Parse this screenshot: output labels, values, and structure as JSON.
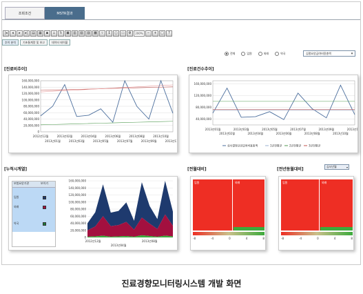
{
  "tabs": [
    {
      "label": "조회조건"
    },
    {
      "label": "MSTR결과"
    }
  ],
  "toolbar": {
    "zoom": "200%"
  },
  "subtabs": [
    {
      "label": "추이 분석"
    },
    {
      "label": "기초통계량 및 보고"
    },
    {
      "label": "데이터 테이블"
    }
  ],
  "filters": {
    "radios": [
      {
        "label": "전체",
        "checked": true
      },
      {
        "label": "입원",
        "checked": false
      },
      {
        "label": "외래",
        "checked": false
      },
      {
        "label": "약국",
        "checked": false
      }
    ],
    "dropdown": "심평요양급여비용총액"
  },
  "sections": {
    "left_top": "[진료비추이]",
    "right_top": "[진료건수추이]",
    "left_bottom": "[누적시계열]",
    "mid_bottom": "[전월대비]",
    "right_bottom": "[전년동월대비]",
    "right_bottom_select": "심사년월"
  },
  "chart_left": {
    "yticks": [
      "160,000,000",
      "140,000,000",
      "120,000,000",
      "100,000,000",
      "80,000,000",
      "60,000,000",
      "40,000,000",
      "20,000,000",
      "0"
    ],
    "xticks_top": [
      "2012년12월",
      "2013년02월",
      "2013년04월",
      "2013년06월",
      "2013년08월",
      "2013년10월"
    ],
    "xticks_bottom": [
      "2013년01월",
      "2013년03월",
      "2013년05월",
      "2013년07월",
      "2013년09월",
      "2013년11월"
    ]
  },
  "chart_right": {
    "yticks": [
      "160,000,000",
      "120,000,000",
      "80,000,000",
      "40,000,000"
    ],
    "xticks_top": [
      "2013년01월",
      "2013년03월",
      "2013년05월",
      "2013년07월",
      "2013년09월",
      "2013년11월"
    ],
    "xticks_bottom": [
      "2013년02월",
      "2013년04월",
      "2013년06월",
      "2013년08월",
      "2013년10월"
    ],
    "legend": [
      "심사결정요양급여비용총액",
      "1년전평균",
      "2년전평균",
      "3년전평균"
    ]
  },
  "chart_data": [
    {
      "type": "line",
      "categories": [
        "2012년12월",
        "2013년01월",
        "2013년02월",
        "2013년03월",
        "2013년04월",
        "2013년05월",
        "2013년06월",
        "2013년07월",
        "2013년08월",
        "2013년09월",
        "2013년10월",
        "2013년11월"
      ],
      "series": [
        {
          "values": [
            50000000,
            80000000,
            148000000,
            48000000,
            52000000,
            72000000,
            30000000,
            160000000,
            80000000,
            40000000,
            160000000,
            58000000
          ]
        },
        {
          "values": [
            130000000,
            131000000,
            132000000,
            133000000,
            134000000,
            135000000,
            136000000,
            137000000,
            138000000,
            139000000,
            140000000,
            141000000
          ]
        },
        {
          "values": [
            125000000,
            127000000,
            129000000,
            131000000,
            133000000,
            135000000,
            137000000,
            139000000,
            141000000,
            143000000,
            145000000,
            147000000
          ]
        },
        {
          "values": [
            22000000,
            23000000,
            24000000,
            25000000,
            26000000,
            27000000,
            28000000,
            29000000,
            30000000,
            31000000,
            32000000,
            33000000
          ]
        }
      ],
      "ylim": [
        0,
        160000000
      ]
    },
    {
      "type": "line",
      "categories": [
        "2013년01월",
        "2013년02월",
        "2013년03월",
        "2013년04월",
        "2013년05월",
        "2013년06월",
        "2013년07월",
        "2013년08월",
        "2013년09월",
        "2013년10월",
        "2013년11월"
      ],
      "series": [
        {
          "name": "심사결정요양급여비용총액",
          "values": [
            60000000,
            145000000,
            46000000,
            48000000,
            65000000,
            38000000,
            128000000,
            75000000,
            44000000,
            155000000,
            55000000
          ]
        },
        {
          "name": "1년전평균",
          "values": [
            70000000,
            70000000,
            70000000,
            70000000,
            70000000,
            70000000,
            70000000,
            70000000,
            70000000,
            70000000,
            70000000
          ]
        },
        {
          "name": "2년전평균",
          "values": [
            100000000,
            100000000,
            100000000,
            100000000,
            100000000,
            100000000,
            100000000,
            100000000,
            100000000,
            100000000,
            100000000
          ]
        },
        {
          "name": "3년전평균",
          "values": [
            72000000,
            72000000,
            72000000,
            72000000,
            72000000,
            72000000,
            72000000,
            72000000,
            72000000,
            72000000,
            72000000
          ]
        }
      ],
      "ylim": [
        20000000,
        170000000
      ]
    },
    {
      "type": "area",
      "categories": [
        "2012년12월",
        "2013년01월",
        "2013년02월",
        "2013년03월",
        "2013년04월",
        "2013년05월",
        "2013년06월",
        "2013년07월",
        "2013년08월",
        "2013년09월",
        "2013년10월",
        "2013년11월"
      ],
      "series": [
        {
          "name": "약국",
          "values": [
            2000000,
            3000000,
            5000000,
            2000000,
            3000000,
            4000000,
            2000000,
            6000000,
            4000000,
            2000000,
            5000000,
            3000000
          ]
        },
        {
          "name": "외래",
          "values": [
            18000000,
            28000000,
            55000000,
            30000000,
            32000000,
            40000000,
            20000000,
            50000000,
            35000000,
            22000000,
            60000000,
            30000000
          ]
        },
        {
          "name": "입원",
          "values": [
            20000000,
            40000000,
            90000000,
            38000000,
            40000000,
            55000000,
            25000000,
            100000000,
            50000000,
            28000000,
            95000000,
            40000000
          ]
        }
      ],
      "ylim": [
        0,
        160000000
      ]
    }
  ],
  "table": {
    "headers": [
      "보험요양기관",
      "보이기"
    ],
    "rows": [
      {
        "label": "입원",
        "color": "#1e3a6e"
      },
      {
        "label": "외래",
        "color": "#a3103f"
      },
      {
        "label": "약국",
        "color": "#1f7a3a"
      }
    ]
  },
  "area_axis": {
    "yticks": [
      "160,000,000",
      "140,000,000",
      "120,000,000",
      "100,000,000",
      "80,000,000",
      "60,000,000",
      "40,000,000",
      "20,000,000",
      "0"
    ],
    "xticks_top": [
      "2012년12월",
      "2013년08월"
    ],
    "xticks_bottom": [
      "2013년04월"
    ]
  },
  "heat1": {
    "labels": [
      "입원",
      "외래"
    ],
    "scale": [
      "-8",
      "-4",
      "0",
      "4",
      "8"
    ]
  },
  "heat2": {
    "labels": [
      "입원",
      "외래"
    ],
    "scale": [
      "-8",
      "-4",
      "0",
      "4",
      "8"
    ]
  },
  "caption": "진료경향모니터링시스템 개발 화면",
  "colors": {
    "red": "#ee2e24",
    "navy": "#1e3a6e",
    "crimson": "#a3103f",
    "green": "#3caa3c",
    "blue": "#4a6d9c"
  }
}
